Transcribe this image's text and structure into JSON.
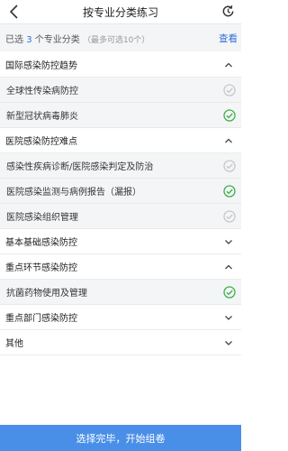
{
  "header": {
    "title": "按专业分类练习"
  },
  "selection": {
    "prefix": "已选",
    "count": "3",
    "suffix": "个专业分类",
    "hint": "（最多可选10个）",
    "view_label": "查看"
  },
  "colors": {
    "accent": "#2f6fd8",
    "check_green": "#3cb24a",
    "check_gray": "#c8c8c8",
    "bar": "#4a8fe7"
  },
  "groups": [
    {
      "label": "国际感染防控趋势",
      "expanded": true,
      "items": [
        {
          "label": "全球性传染病防控",
          "checked": false
        },
        {
          "label": "新型冠状病毒肺炎",
          "checked": true
        }
      ]
    },
    {
      "label": "医院感染防控难点",
      "expanded": true,
      "items": [
        {
          "label": "感染性疾病诊断/医院感染判定及防治",
          "checked": false
        },
        {
          "label": "医院感染监测与病例报告（漏报）",
          "checked": true
        },
        {
          "label": "医院感染组织管理",
          "checked": false
        }
      ]
    },
    {
      "label": "基本基础感染防控",
      "expanded": false,
      "items": []
    },
    {
      "label": "重点环节感染防控",
      "expanded": true,
      "items": [
        {
          "label": "抗菌药物使用及管理",
          "checked": true
        }
      ]
    },
    {
      "label": "重点部门感染防控",
      "expanded": false,
      "items": []
    },
    {
      "label": "其他",
      "expanded": false,
      "items": []
    }
  ],
  "footer": {
    "button_label": "选择完毕，开始组卷"
  }
}
